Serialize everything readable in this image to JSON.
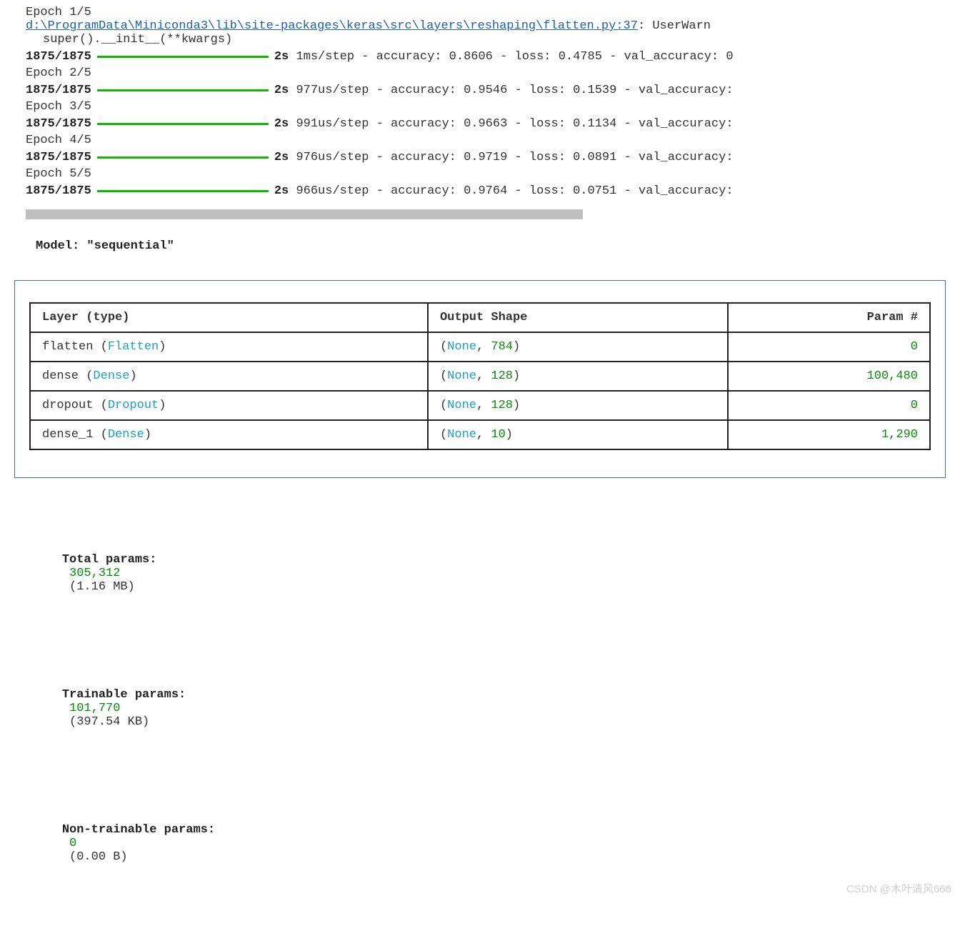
{
  "training": {
    "warning_path": "d:\\ProgramData\\Miniconda3\\lib\\site-packages\\keras\\src\\layers\\reshaping\\flatten.py:37",
    "warning_suffix": ": UserWarn",
    "warning_line2": "super().__init__(**kwargs)",
    "epochs": [
      {
        "label": "Epoch 1/5",
        "steps": "1875/1875",
        "time": "2s",
        "metrics": "1ms/step - accuracy: 0.8606 - loss: 0.4785 - val_accuracy: 0"
      },
      {
        "label": "Epoch 2/5",
        "steps": "1875/1875",
        "time": "2s",
        "metrics": "977us/step - accuracy: 0.9546 - loss: 0.1539 - val_accuracy:"
      },
      {
        "label": "Epoch 3/5",
        "steps": "1875/1875",
        "time": "2s",
        "metrics": "991us/step - accuracy: 0.9663 - loss: 0.1134 - val_accuracy:"
      },
      {
        "label": "Epoch 4/5",
        "steps": "1875/1875",
        "time": "2s",
        "metrics": "976us/step - accuracy: 0.9719 - loss: 0.0891 - val_accuracy:"
      },
      {
        "label": "Epoch 5/5",
        "steps": "1875/1875",
        "time": "2s",
        "metrics": "966us/step - accuracy: 0.9764 - loss: 0.0751 - val_accuracy:"
      }
    ]
  },
  "model": {
    "title": "Model: \"sequential\"",
    "headers": {
      "layer": "Layer (type)",
      "shape": "Output Shape",
      "param": "Param #"
    },
    "rows": [
      {
        "name": "flatten",
        "type": "Flatten",
        "shape_none": "None",
        "shape_dim": "784",
        "params": "0"
      },
      {
        "name": "dense",
        "type": "Dense",
        "shape_none": "None",
        "shape_dim": "128",
        "params": "100,480"
      },
      {
        "name": "dropout",
        "type": "Dropout",
        "shape_none": "None",
        "shape_dim": "128",
        "params": "0"
      },
      {
        "name": "dense_1",
        "type": "Dense",
        "shape_none": "None",
        "shape_dim": "10",
        "params": "1,290"
      }
    ]
  },
  "params": {
    "total": {
      "label": "Total params:",
      "value": "305,312",
      "size": "(1.16 MB)"
    },
    "trainable": {
      "label": "Trainable params:",
      "value": "101,770",
      "size": "(397.54 KB)"
    },
    "nontrainable": {
      "label": "Non-trainable params:",
      "value": "0",
      "size": "(0.00 B)"
    }
  },
  "watermark": "CSDN @木叶清风666"
}
